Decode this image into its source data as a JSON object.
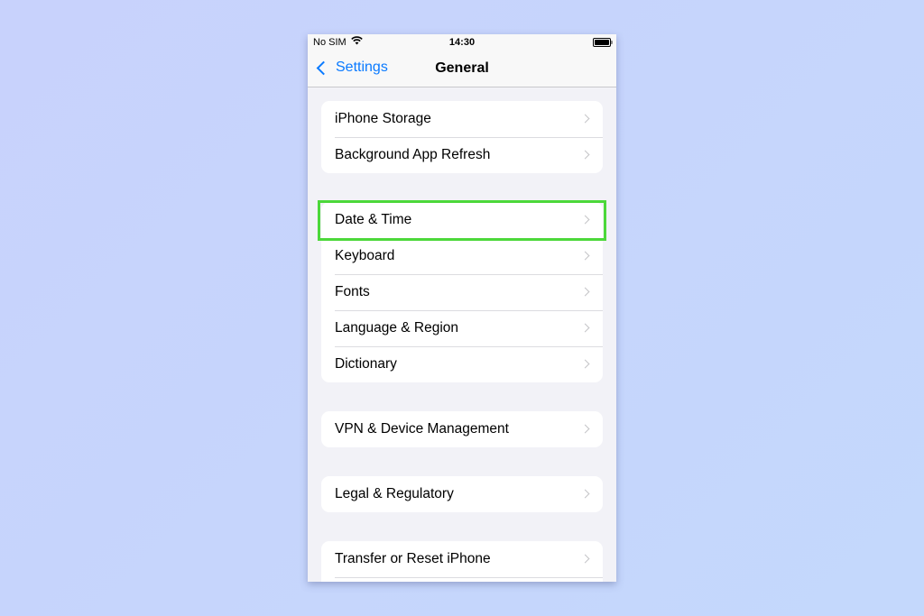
{
  "status_bar": {
    "carrier": "No SIM",
    "time": "14:30",
    "icons": [
      "wifi-icon",
      "battery-icon"
    ]
  },
  "nav": {
    "back_label": "Settings",
    "title": "General"
  },
  "groups": [
    {
      "items": [
        {
          "label": "iPhone Storage"
        },
        {
          "label": "Background App Refresh"
        }
      ]
    },
    {
      "items": [
        {
          "label": "Date & Time"
        },
        {
          "label": "Keyboard"
        },
        {
          "label": "Fonts"
        },
        {
          "label": "Language & Region"
        },
        {
          "label": "Dictionary"
        }
      ]
    },
    {
      "items": [
        {
          "label": "VPN & Device Management"
        }
      ]
    },
    {
      "items": [
        {
          "label": "Legal & Regulatory"
        }
      ]
    },
    {
      "items": [
        {
          "label": "Transfer or Reset iPhone"
        },
        {
          "label": ""
        }
      ]
    }
  ],
  "highlight": {
    "target": "Date & Time",
    "color": "#4cd83a"
  },
  "colors": {
    "accent": "#0a7aff",
    "background": "#c8d4fb"
  }
}
